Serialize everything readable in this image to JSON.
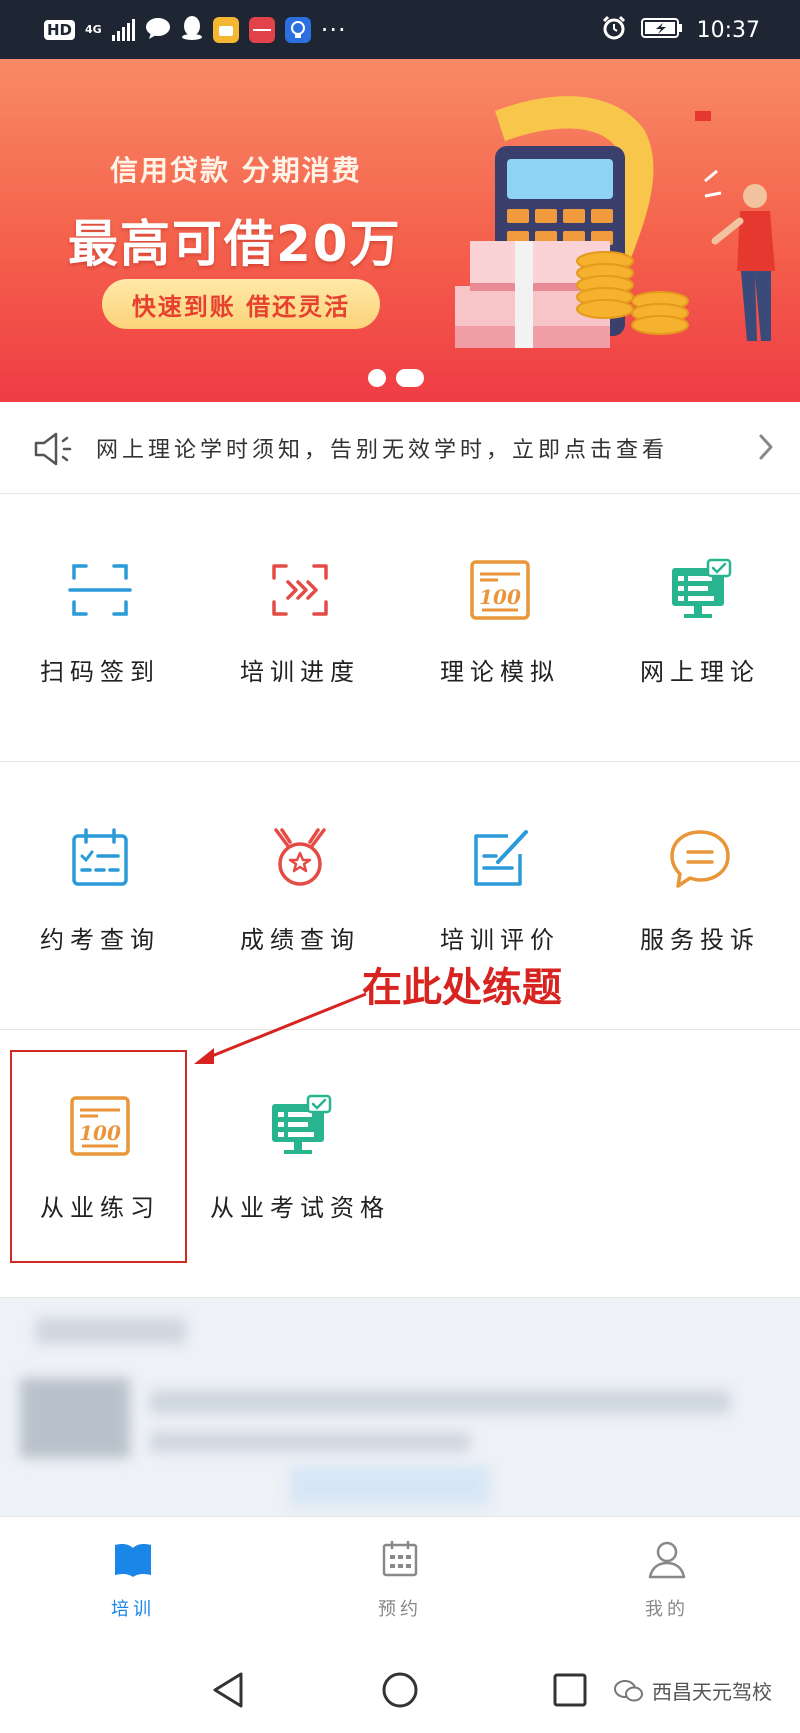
{
  "status_bar": {
    "hd": "HD",
    "network": "4G",
    "time": "10:37"
  },
  "banner": {
    "subtitle": "信用贷款  分期消费",
    "headline": "最高可借20万",
    "pill": "快速到账  借还灵活"
  },
  "notice": {
    "text": "网上理论学时须知，告别无效学时，立即点击查看"
  },
  "grid": {
    "row1": [
      {
        "label": "扫码签到",
        "icon": "scan-icon",
        "color": "#2a9ad8"
      },
      {
        "label": "培训进度",
        "icon": "progress-icon",
        "color": "#e54b45"
      },
      {
        "label": "理论模拟",
        "icon": "exam-100-icon",
        "color": "#e9953a"
      },
      {
        "label": "网上理论",
        "icon": "online-theory-icon",
        "color": "#27b48f"
      }
    ],
    "row2": [
      {
        "label": "约考查询",
        "icon": "calendar-icon",
        "color": "#2a9ad8"
      },
      {
        "label": "成绩查询",
        "icon": "medal-icon",
        "color": "#e54b45"
      },
      {
        "label": "培训评价",
        "icon": "evaluate-icon",
        "color": "#2a9ad8"
      },
      {
        "label": "服务投诉",
        "icon": "chat-icon",
        "color": "#e9953a"
      }
    ],
    "row3": [
      {
        "label": "从业练习",
        "icon": "exam-100-icon",
        "color": "#e9953a"
      },
      {
        "label": "从业考试资格",
        "icon": "online-theory-icon",
        "color": "#27b48f"
      }
    ]
  },
  "annotation": {
    "text": "在此处练题",
    "color": "#d72420"
  },
  "tabs": [
    {
      "label": "培训",
      "icon": "book-icon",
      "active": true
    },
    {
      "label": "预约",
      "icon": "calendar-grid-icon",
      "active": false
    },
    {
      "label": "我的",
      "icon": "person-icon",
      "active": false
    }
  ],
  "watermark": {
    "text": "西昌天元驾校"
  }
}
